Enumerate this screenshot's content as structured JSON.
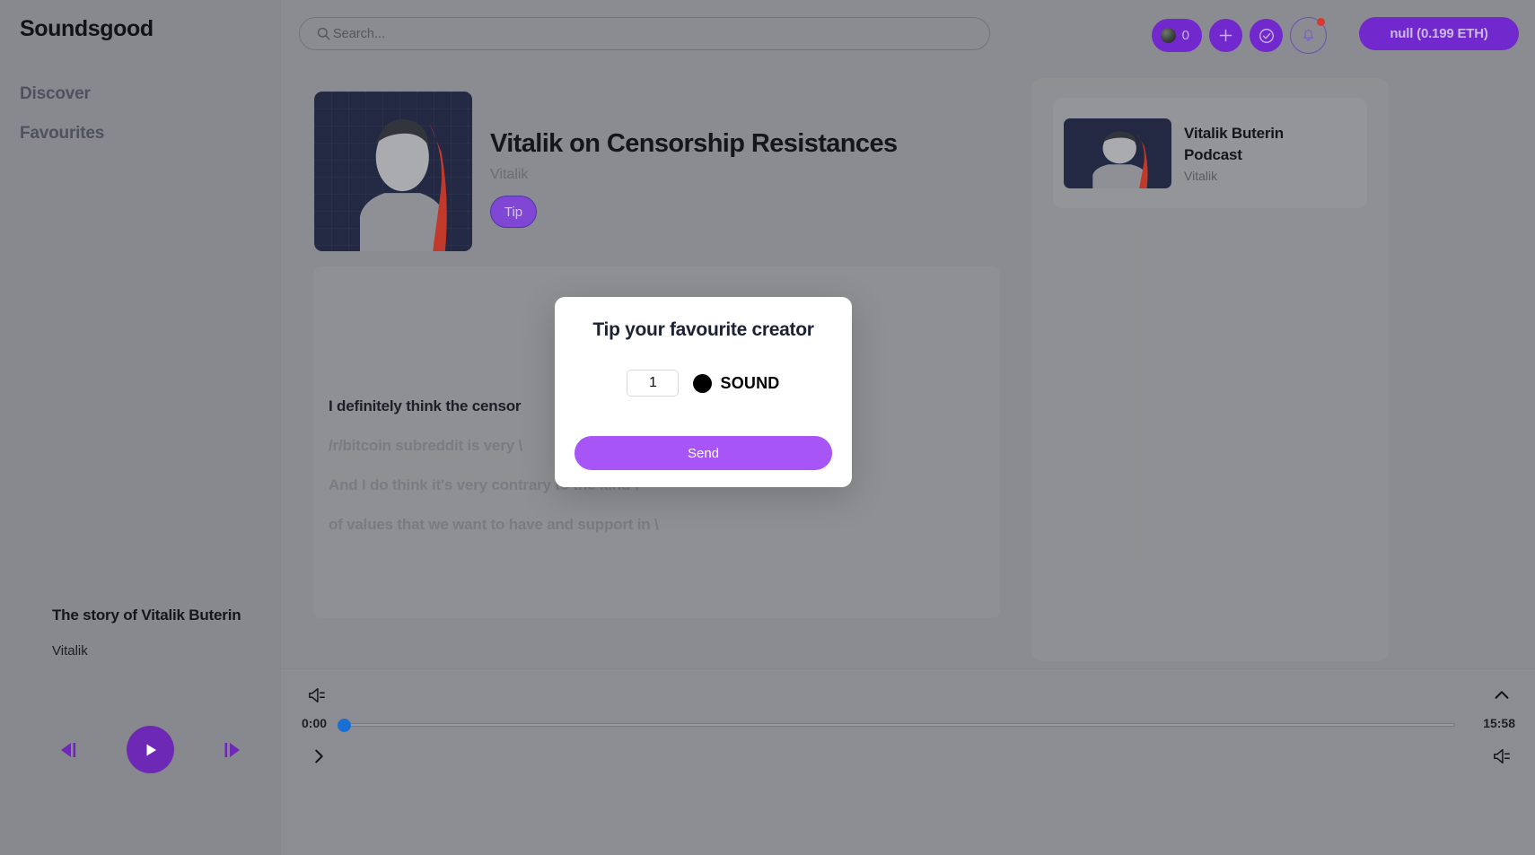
{
  "app": {
    "brand": "Soundsgood"
  },
  "sidebar": {
    "items": [
      {
        "label": "Discover",
        "icon": "compass-icon"
      },
      {
        "label": "Favourites",
        "icon": "heart-icon"
      }
    ]
  },
  "topbar": {
    "search": {
      "placeholder": "Search...",
      "value": "",
      "icon": "search-icon"
    },
    "token_badge": {
      "count": "0",
      "icon": "token-globe-icon"
    },
    "add_button": {
      "label": "+",
      "icon": "plus-icon"
    },
    "verify_button": {
      "icon": "check-circle-icon"
    },
    "notifications": {
      "icon": "bell-icon",
      "has_unread": true,
      "dot_color": "#d9392f"
    },
    "wallet": {
      "label": "null (0.199 ETH)"
    }
  },
  "episode": {
    "title": "Vitalik on Censorship Resistances",
    "artist": "Vitalik",
    "tip_label": "Tip",
    "cover_icon": "episode-cover-art"
  },
  "transcript": {
    "lines": [
      {
        "text": "I definitely think the censor",
        "state": "active"
      },
      {
        "text": "/r/bitcoin subreddit is very \\",
        "state": "dim"
      },
      {
        "text": "And I do think it's very contrary to the kind \\",
        "state": "dim"
      },
      {
        "text": "of values that we want to have and support in \\",
        "state": "dim"
      }
    ]
  },
  "related": {
    "card": {
      "title": "Vitalik Buterin Podcast",
      "artist": "Vitalik",
      "thumb_icon": "podcast-thumbnail"
    }
  },
  "now_playing": {
    "title": "The story of Vitalik Buterin",
    "artist": "Vitalik",
    "previous_icon": "previous-track-icon",
    "play_icon": "play-icon",
    "next_icon": "next-track-icon",
    "is_playing": false
  },
  "player_bar": {
    "current_time": "0:00",
    "total_time": "15:58",
    "progress_percent": 0,
    "mute_icon": "speaker-icon",
    "collapse_icon": "chevron-up-icon",
    "expand_icon": "chevron-right-icon",
    "volume_icon": "speaker-icon",
    "thumb_color": "#1a6fd4"
  },
  "modal": {
    "title": "Tip your favourite creator",
    "amount_value": "1",
    "amount_placeholder": "1",
    "token_symbol": "SOUND",
    "token_icon": "sound-token-icon",
    "send_label": "Send"
  },
  "colors": {
    "accent_purple": "#7128cc",
    "modal_send": "#a855f7",
    "tip_button": "#7f47d4",
    "play_button": "#6d28b5",
    "slider_thumb": "#1a6fd4",
    "notification_dot": "#d9392f",
    "page_bg": "#8b8c91"
  }
}
